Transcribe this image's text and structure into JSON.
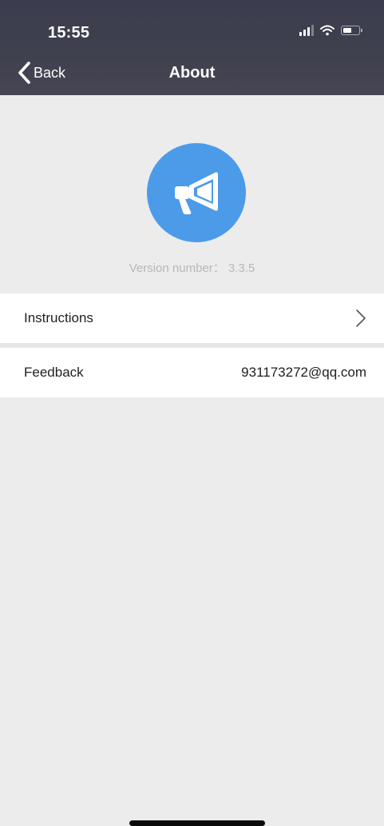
{
  "status_bar": {
    "time": "15:55",
    "signal_icon": "signal-bars",
    "wifi_icon": "wifi",
    "battery_icon": "battery",
    "battery_level": 0.5
  },
  "nav": {
    "back_label": "Back",
    "title": "About"
  },
  "logo": {
    "icon": "megaphone-icon",
    "color": "#4c9be9"
  },
  "version": {
    "text": "Version number： 3.3.5"
  },
  "rows": {
    "instructions": {
      "label": "Instructions",
      "chevron_icon": "chevron-right"
    },
    "feedback": {
      "label": "Feedback",
      "value": "931173272@qq.com"
    }
  },
  "colors": {
    "header": "#40414f",
    "background": "#ececec",
    "row_background": "#ffffff",
    "accent": "#4c9be9"
  }
}
